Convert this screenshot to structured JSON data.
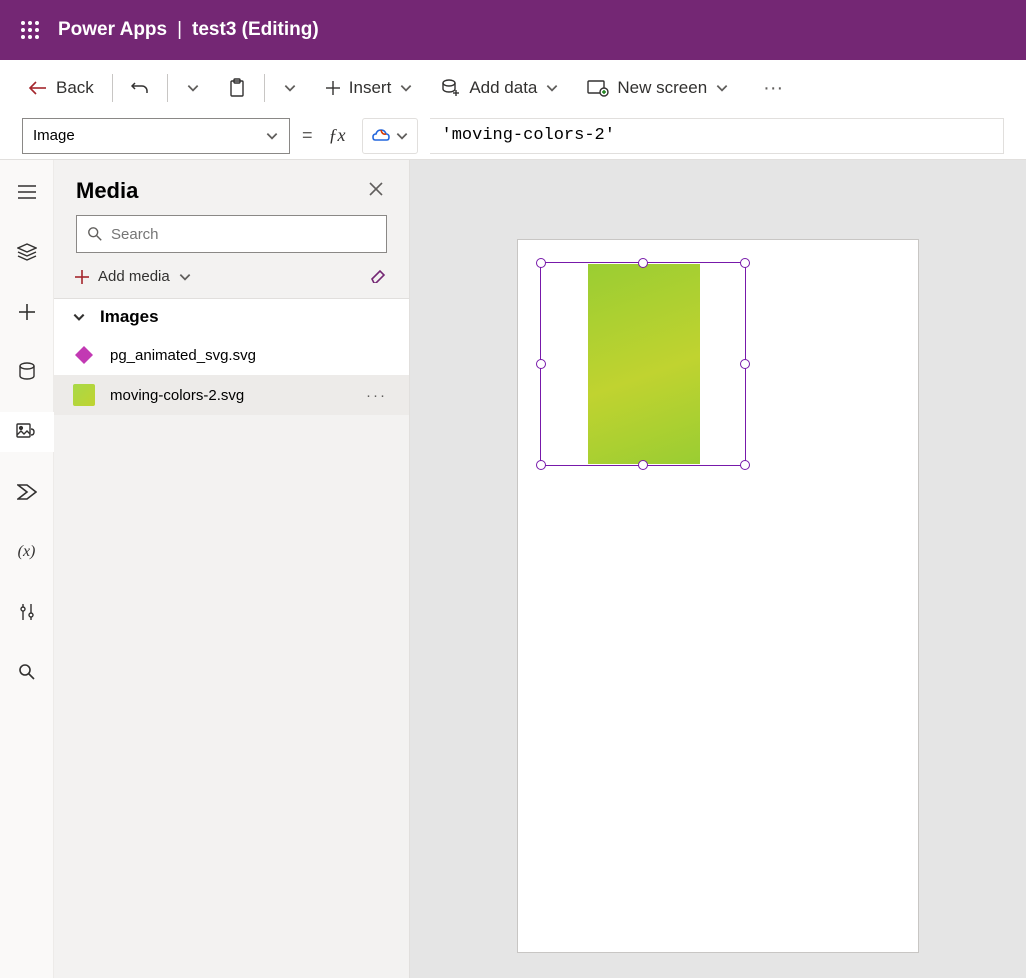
{
  "header": {
    "app": "Power Apps",
    "sep": "|",
    "file": "test3 (Editing)"
  },
  "cmd": {
    "back": "Back",
    "insert": "Insert",
    "add_data": "Add data",
    "new_screen": "New screen"
  },
  "formula": {
    "property": "Image",
    "value": "'moving-colors-2'"
  },
  "panel": {
    "title": "Media",
    "search_placeholder": "Search",
    "add_media": "Add media",
    "category": "Images",
    "files": [
      {
        "name": "pg_animated_svg.svg"
      },
      {
        "name": "moving-colors-2.svg"
      }
    ]
  },
  "colors": {
    "brand": "#742774"
  }
}
